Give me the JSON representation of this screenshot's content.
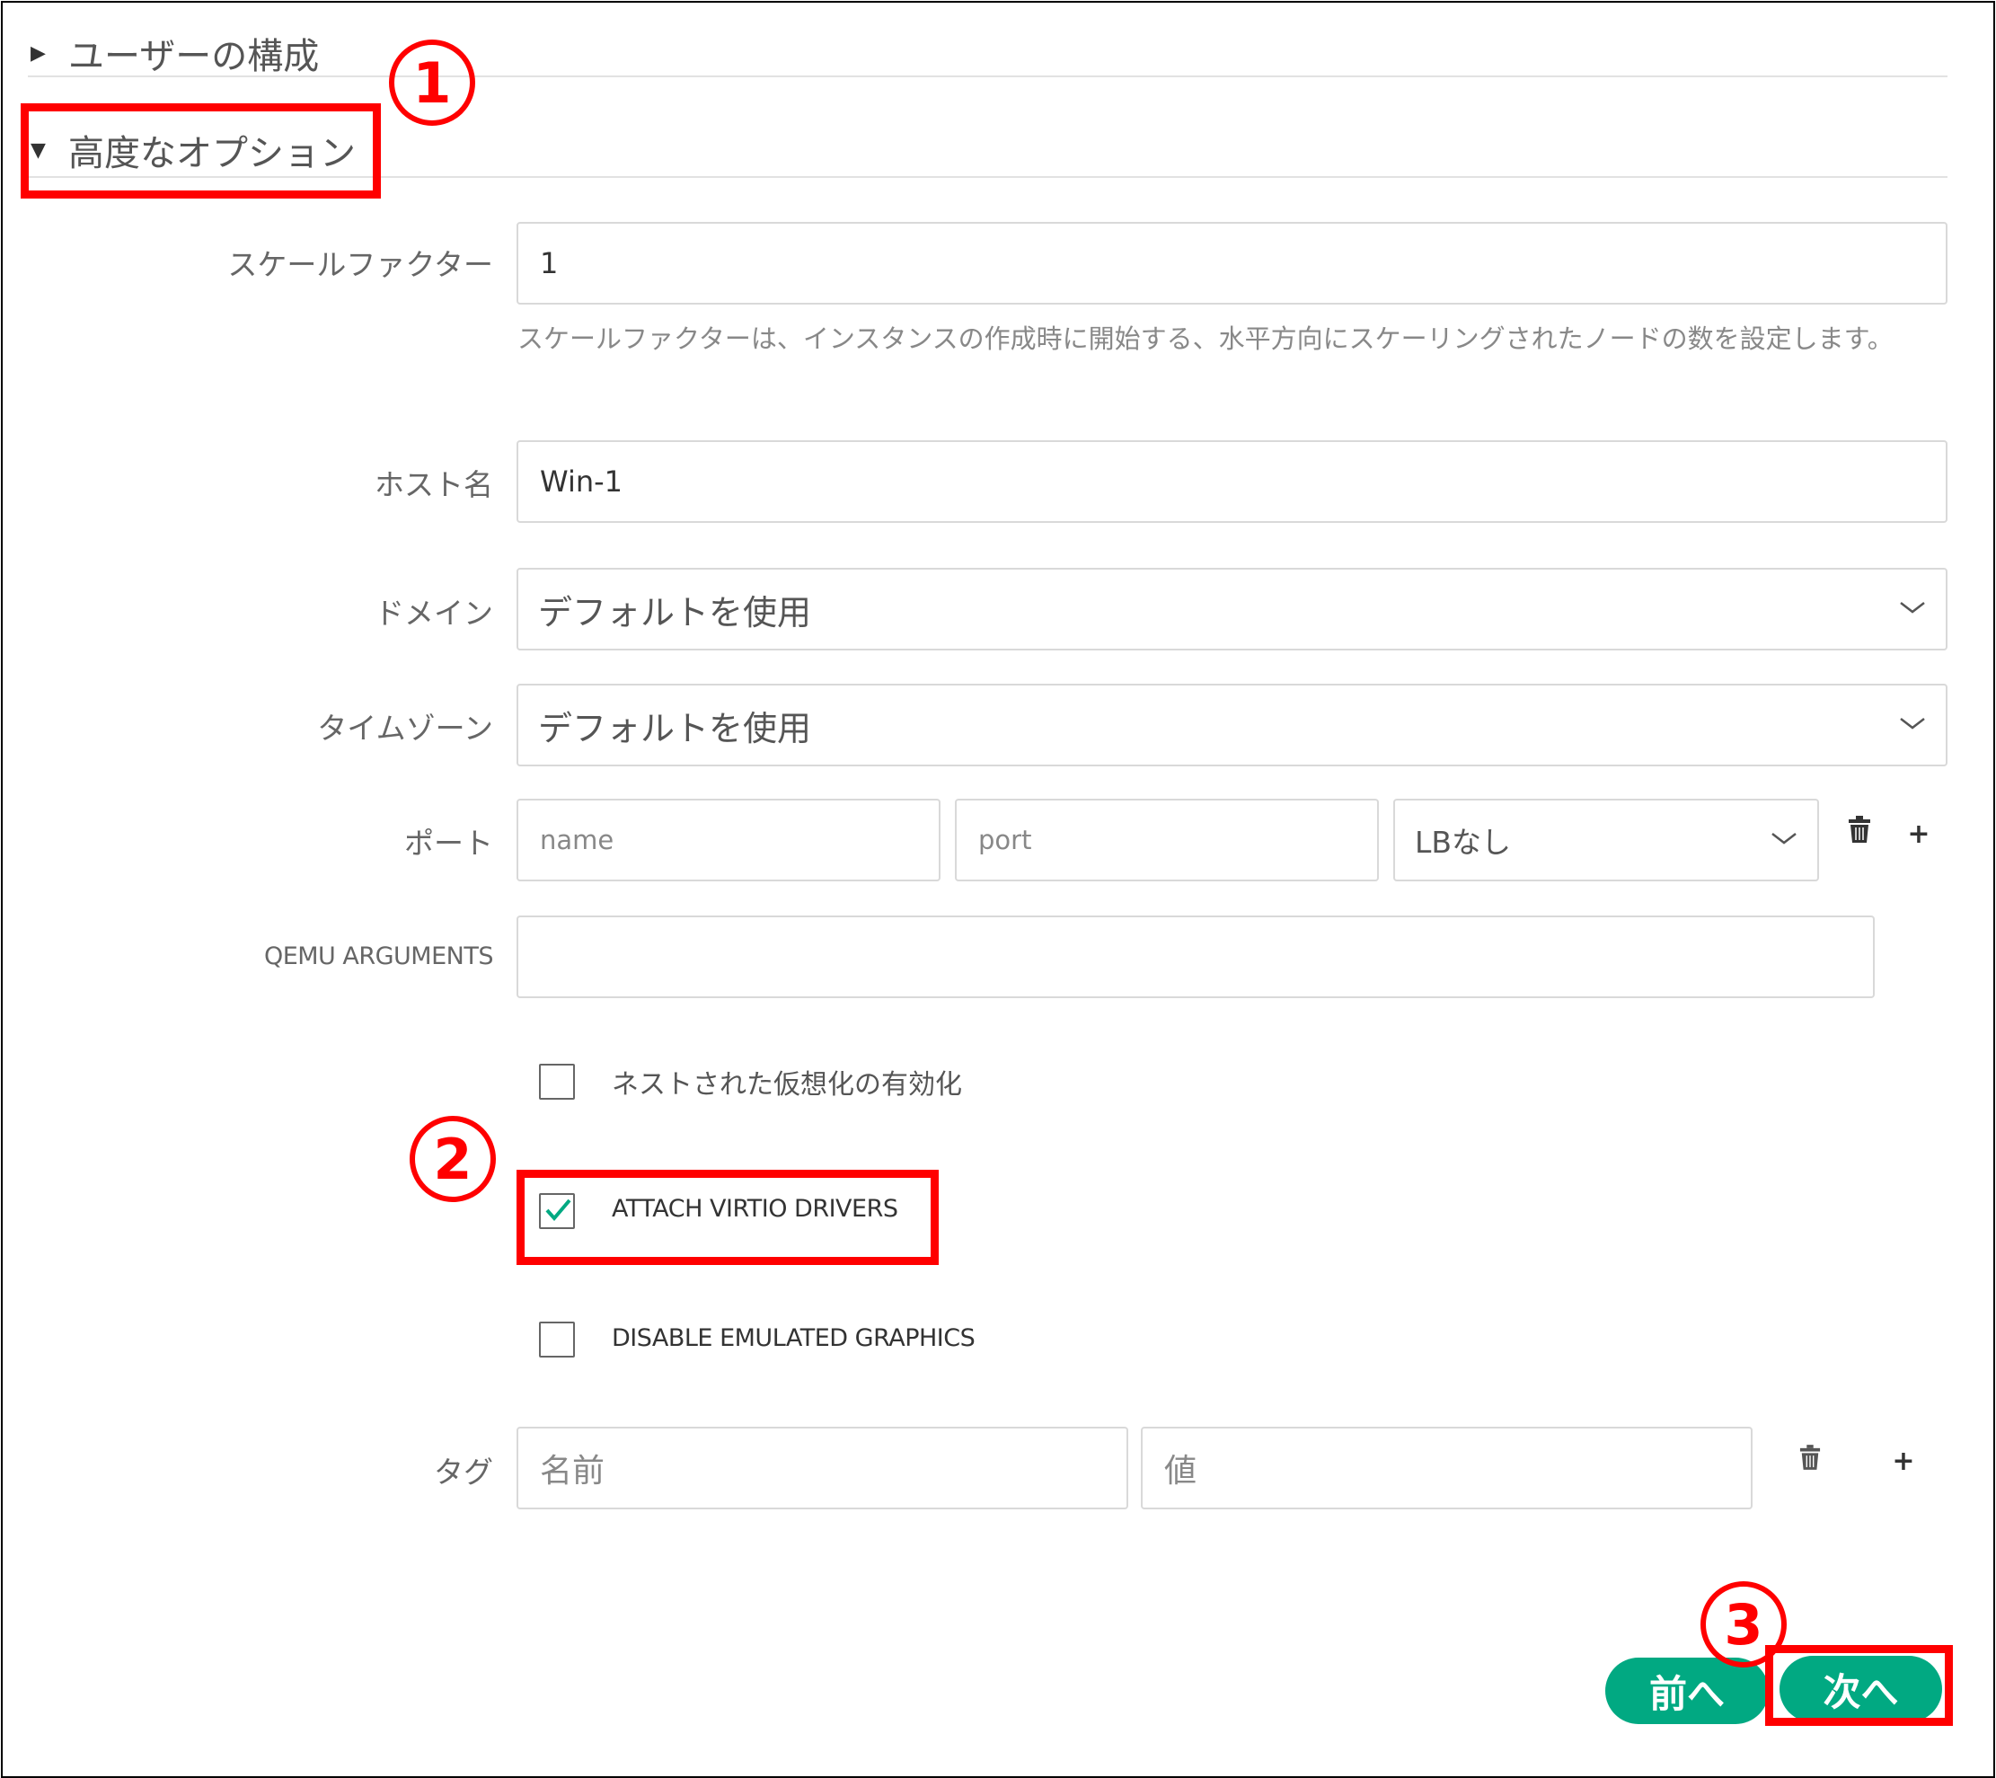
{
  "sections": {
    "user_config": "ユーザーの構成",
    "advanced": "高度なオプション"
  },
  "fields": {
    "scale_factor": {
      "label": "スケールファクター",
      "value": "1",
      "help": "スケールファクターは、インスタンスの作成時に開始する、水平方向にスケーリングされたノードの数を設定します。"
    },
    "hostname": {
      "label": "ホスト名",
      "value": "Win-1"
    },
    "domain": {
      "label": "ドメイン",
      "value": "デフォルトを使用"
    },
    "timezone": {
      "label": "タイムゾーン",
      "value": "デフォルトを使用"
    },
    "port": {
      "label": "ポート",
      "name_placeholder": "name",
      "port_placeholder": "port",
      "lb_value": "LBなし"
    },
    "qemu": {
      "label": "QEMU ARGUMENTS",
      "value": ""
    },
    "tags": {
      "label": "タグ",
      "name_placeholder": "名前",
      "value_placeholder": "値"
    }
  },
  "checkboxes": {
    "nested_virtualization": {
      "label": "ネストされた仮想化の有効化",
      "checked": false
    },
    "attach_virtio": {
      "label": "ATTACH VIRTIO DRIVERS",
      "checked": true
    },
    "disable_graphics": {
      "label": "DISABLE EMULATED GRAPHICS",
      "checked": false
    }
  },
  "buttons": {
    "prev": "前へ",
    "next": "次へ"
  },
  "annotations": {
    "step1": "1",
    "step2": "2",
    "step3": "3"
  },
  "icons": {
    "expand_collapsed": "triangle-right-icon",
    "expand_open": "triangle-down-icon",
    "trash": "trash-icon",
    "add": "plus-icon",
    "dropdown": "chevron-down-icon"
  },
  "colors": {
    "accent": "#01a982",
    "check": "#01a982",
    "annotation": "#ff0000"
  }
}
